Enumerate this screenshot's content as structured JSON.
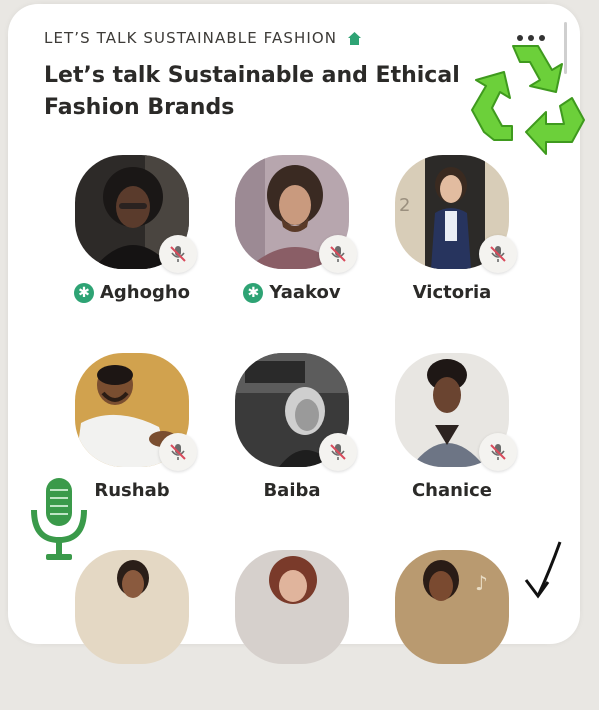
{
  "room": {
    "club_name": "LET’S TALK SUSTAINABLE FASHION",
    "title": "Let’s talk Sustainable and Ethical Fashion Brands"
  },
  "colors": {
    "accent_green": "#2ea374",
    "recycle_green": "#6cd03a",
    "mic_green": "#3a9a4a",
    "muted_red": "#d94b5c"
  },
  "icons": {
    "club": "house-icon",
    "menu": "more-icon",
    "sticker": "recycle-icon",
    "moderator": "moderator-asterisk-icon",
    "muted": "mic-muted-icon",
    "overlay_mic": "microphone-icon",
    "overlay_arrow": "arrow-down-icon"
  },
  "speakers": [
    {
      "name": "Aghogho",
      "moderator": true,
      "muted": true
    },
    {
      "name": "Yaakov",
      "moderator": true,
      "muted": true
    },
    {
      "name": "Victoria",
      "moderator": false,
      "muted": true
    },
    {
      "name": "Rushab",
      "moderator": false,
      "muted": true
    },
    {
      "name": "Baiba",
      "moderator": false,
      "muted": true
    },
    {
      "name": "Chanice",
      "moderator": false,
      "muted": true
    }
  ]
}
